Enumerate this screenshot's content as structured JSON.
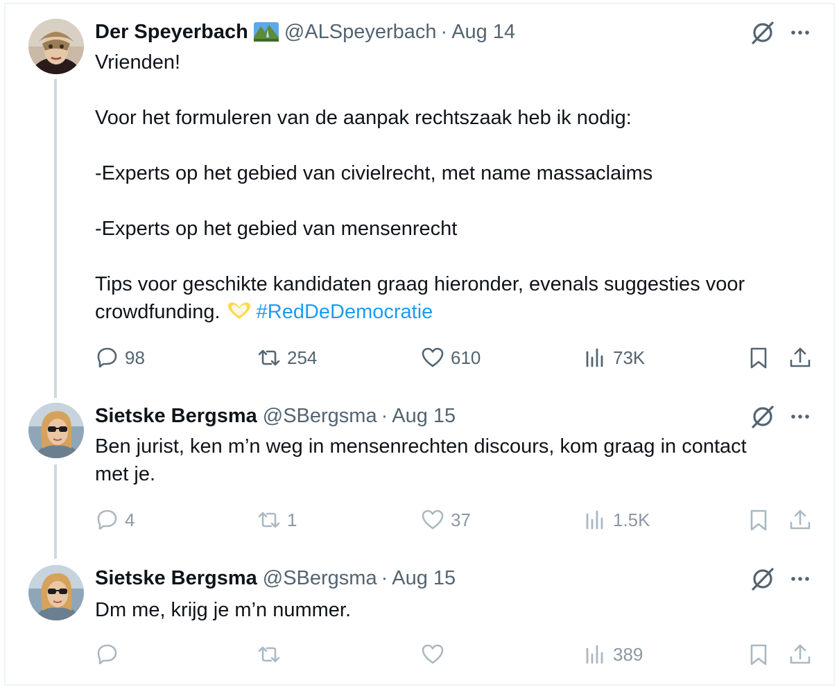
{
  "tweets": [
    {
      "author_name": "Der Speyerbach",
      "badge_icon": "landscape-emoji",
      "handle": "@ALSpeyerbach",
      "separator": "·",
      "date": "Aug 14",
      "text_lines": [
        "Vrienden!",
        "",
        "Voor het formuleren van de aanpak rechtszaak heb ik nodig:",
        "",
        "-Experts op het gebied van civielrecht, met name massaclaims",
        "",
        "-Experts op het gebied van mensenrecht",
        "",
        "Tips voor geschikte kandidaten graag hieronder, evenals suggesties voor"
      ],
      "last_line_text": "crowdfunding.",
      "last_line_emoji": "heart-hands-emoji",
      "hashtag": "#RedDeDemocratie",
      "replies": "98",
      "reposts": "254",
      "likes": "610",
      "views": "73K"
    },
    {
      "author_name": "Sietske Bergsma",
      "handle": "@SBergsma",
      "separator": "·",
      "date": "Aug 15",
      "text_line1": "Ben jurist, ken m’n weg in mensenrechten discours, kom graag in contact",
      "text_line2": "met je.",
      "replies": "4",
      "reposts": "1",
      "likes": "37",
      "views": "1.5K"
    },
    {
      "author_name": "Sietske Bergsma",
      "handle": "@SBergsma",
      "separator": "·",
      "date": "Aug 15",
      "text_line1": "Dm me, krijg je m’n nummer.",
      "replies": "",
      "reposts": "",
      "likes": "",
      "views": "389"
    }
  ],
  "colors": {
    "text": "#0f1419",
    "secondary": "#536471",
    "link": "#1d9bf0",
    "thread_line": "#cfd9de",
    "border": "#eff3f4"
  }
}
